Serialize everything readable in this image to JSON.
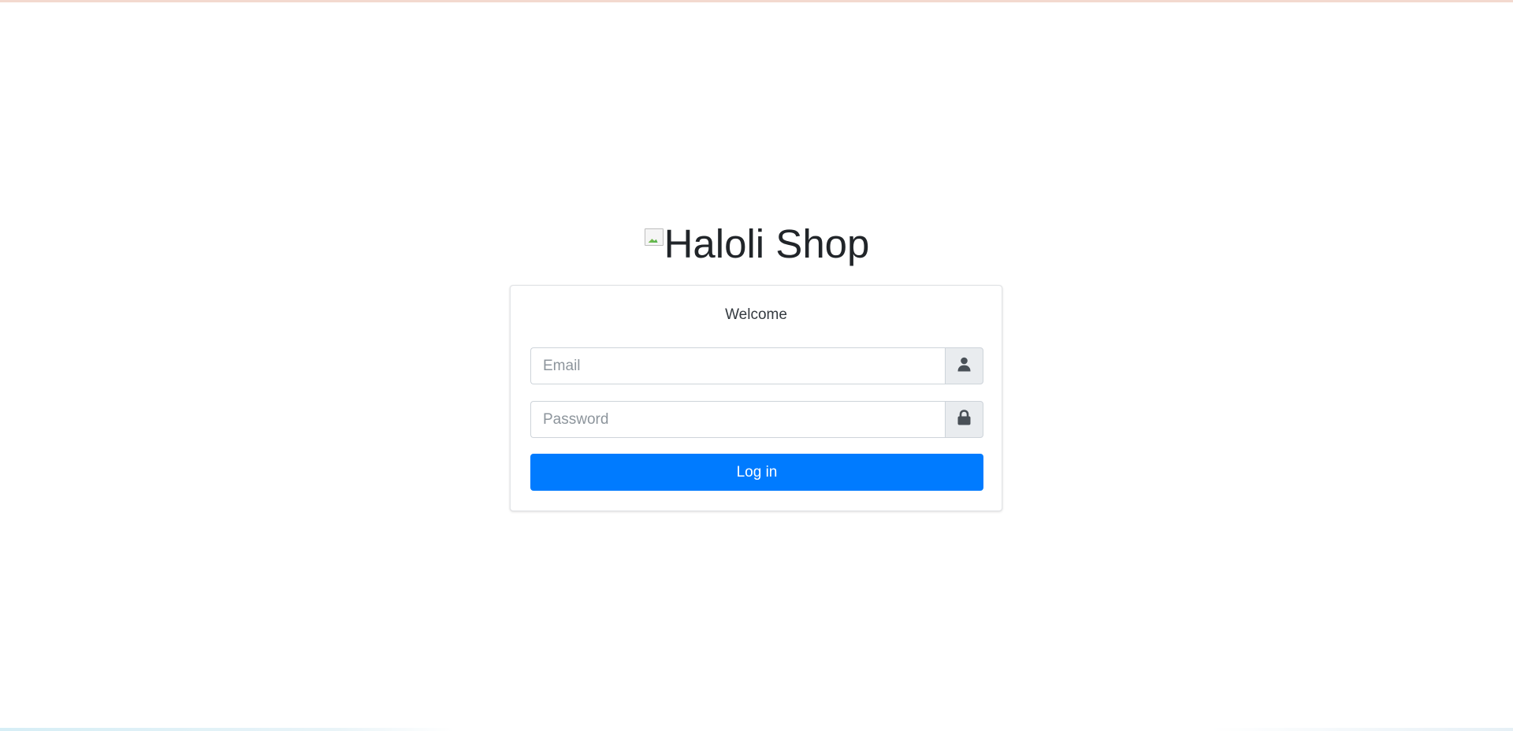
{
  "brand": {
    "text": "Haloli Shop",
    "image_icon": "broken-image-icon"
  },
  "card": {
    "welcome": "Welcome"
  },
  "form": {
    "email": {
      "placeholder": "Email",
      "value": "",
      "icon": "user-icon"
    },
    "password": {
      "placeholder": "Password",
      "value": "",
      "icon": "lock-icon"
    },
    "submit_label": "Log in"
  },
  "colors": {
    "primary": "#007bff",
    "addon_bg": "#e9ecef",
    "icon": "#495057"
  }
}
